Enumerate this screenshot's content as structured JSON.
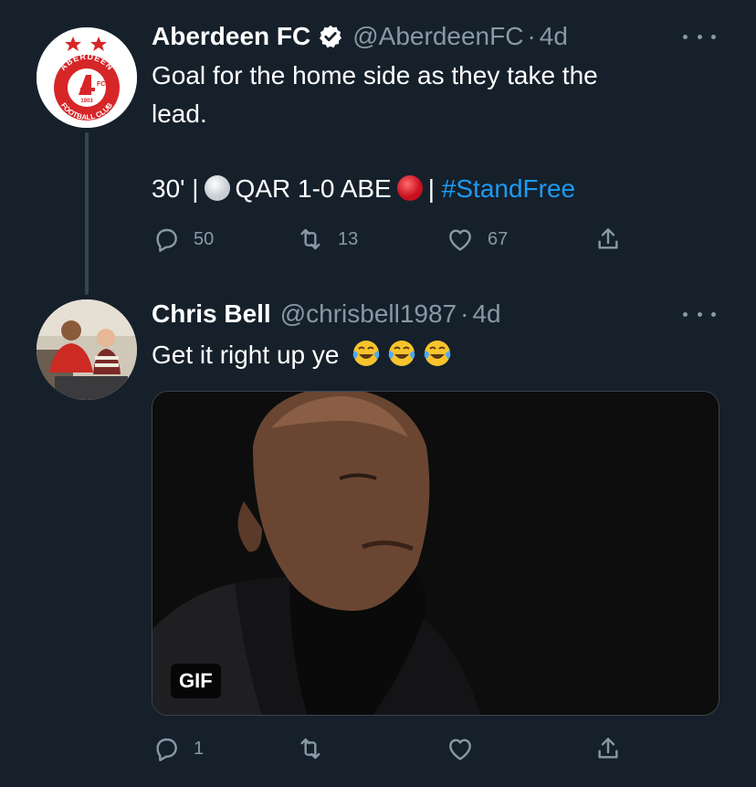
{
  "tweets": [
    {
      "name": "Aberdeen FC",
      "handle": "@AberdeenFC",
      "separator": "·",
      "time": "4d",
      "avatar_lettering": [
        "ABERDEEN",
        "FOOTBALL CLUB",
        "1903",
        "FC"
      ],
      "text_line1": "Goal for the home side as they take the",
      "text_line2": "lead.",
      "score_prefix": "30' |",
      "score_middle": "QAR 1-0 ABE",
      "score_sep": "|",
      "hashtag": "#StandFree",
      "actions": {
        "replies": "50",
        "retweets": "13",
        "likes": "67"
      }
    },
    {
      "name": "Chris Bell",
      "handle": "@chrisbell1987",
      "separator": "·",
      "time": "4d",
      "text": "Get it right up ye",
      "media_badge": "GIF",
      "actions": {
        "replies": "1",
        "retweets": "",
        "likes": ""
      }
    }
  ],
  "icons": {
    "verified": "verified-badge-icon",
    "more": "more-options-icon",
    "reply": "reply-icon",
    "retweet": "retweet-icon",
    "like": "heart-icon",
    "share": "share-icon",
    "emoji": "face-with-tears-of-joy-icon"
  },
  "colors": {
    "background": "#15202b",
    "text": "#ffffff",
    "secondary": "#8899a6",
    "link": "#1d9bf0",
    "aberdeen_red": "#d72628"
  }
}
